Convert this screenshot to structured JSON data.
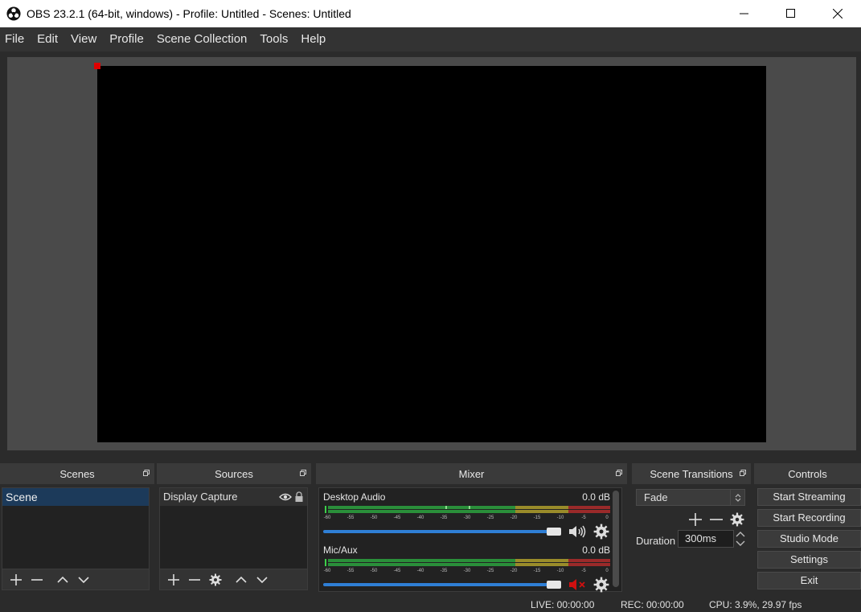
{
  "window": {
    "title": "OBS 23.2.1 (64-bit, windows) - Profile: Untitled - Scenes: Untitled"
  },
  "menu": [
    "File",
    "Edit",
    "View",
    "Profile",
    "Scene Collection",
    "Tools",
    "Help"
  ],
  "scenes": {
    "title": "Scenes",
    "items": [
      "Scene"
    ]
  },
  "sources": {
    "title": "Sources",
    "items": [
      "Display Capture"
    ]
  },
  "mixer": {
    "title": "Mixer",
    "ticks": [
      "-60",
      "-55",
      "-50",
      "-45",
      "-40",
      "-35",
      "-30",
      "-25",
      "-20",
      "-15",
      "-10",
      "-5",
      "0"
    ],
    "channels": [
      {
        "name": "Desktop Audio",
        "level": "0.0 dB",
        "muted": false,
        "volume": 1.0
      },
      {
        "name": "Mic/Aux",
        "level": "0.0 dB",
        "muted": true,
        "volume": 1.0
      }
    ]
  },
  "transitions": {
    "title": "Scene Transitions",
    "selected": "Fade",
    "duration_label": "Duration",
    "duration_value": "300ms"
  },
  "controls": {
    "title": "Controls",
    "buttons": [
      "Start Streaming",
      "Start Recording",
      "Studio Mode",
      "Settings",
      "Exit"
    ]
  },
  "status": {
    "live": "LIVE: 00:00:00",
    "rec": "REC: 00:00:00",
    "cpu": "CPU: 3.9%, 29.97 fps"
  },
  "colors": {
    "meter_green": "#2a8f3a",
    "meter_yellow": "#9a8c2a",
    "meter_red": "#9a2a2a",
    "fader": "#2f7fd6",
    "mute_red": "#d01010",
    "selection": "#1c3a5a"
  }
}
